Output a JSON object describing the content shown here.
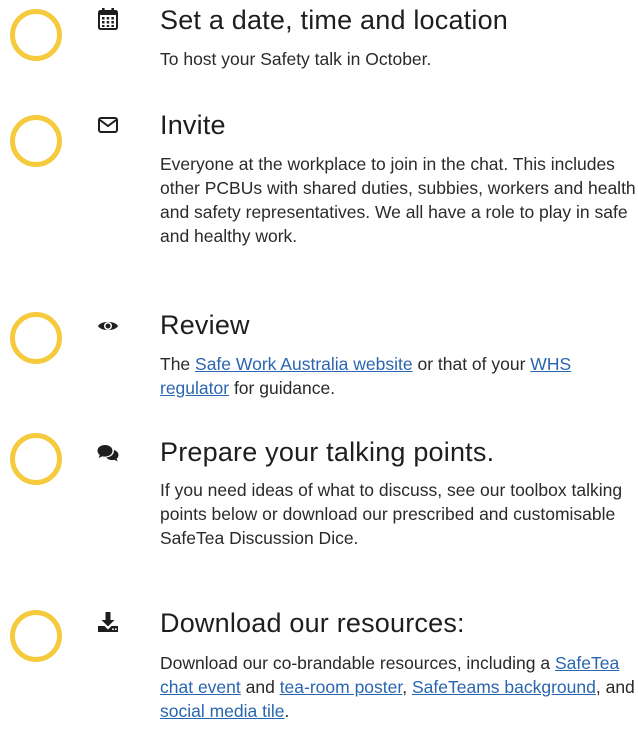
{
  "steps": [
    {
      "icon": "calendar-icon",
      "title": "Set a date, time and location",
      "desc": {
        "text": "To host your Safety talk in October."
      }
    },
    {
      "icon": "envelope-icon",
      "title": "Invite",
      "desc": {
        "text": "Everyone at the workplace to join in the chat. This includes other PCBUs with shared duties, subbies, workers and health and safety representatives. We all have a role to play in safe and healthy work."
      }
    },
    {
      "icon": "eye-icon",
      "title": "Review",
      "desc": {
        "t1": "The ",
        "link1": "Safe Work Australia website",
        "t2": " or that of your ",
        "link2": "WHS regulator",
        "t3": " for guidance."
      }
    },
    {
      "icon": "comments-icon",
      "title": "Prepare your talking points.",
      "desc": {
        "text": "If you need ideas of what to discuss, see our toolbox talking points below or download our prescribed and customisable SafeTea Discussion Dice."
      }
    },
    {
      "icon": "download-icon",
      "title": "Download our resources:",
      "desc": {
        "t1": "Download our co-brandable resources, including a ",
        "link1": "SafeTea chat event",
        "t2": " and ",
        "link2": "tea-room poster",
        "t3": ", ",
        "link3": "SafeTeams background",
        "t4": ", and ",
        "link4": "social media tile",
        "t5": "."
      }
    }
  ],
  "colors": {
    "circle": "#f5ca3c",
    "link": "#2a66b0",
    "text": "#1e1e1e"
  }
}
